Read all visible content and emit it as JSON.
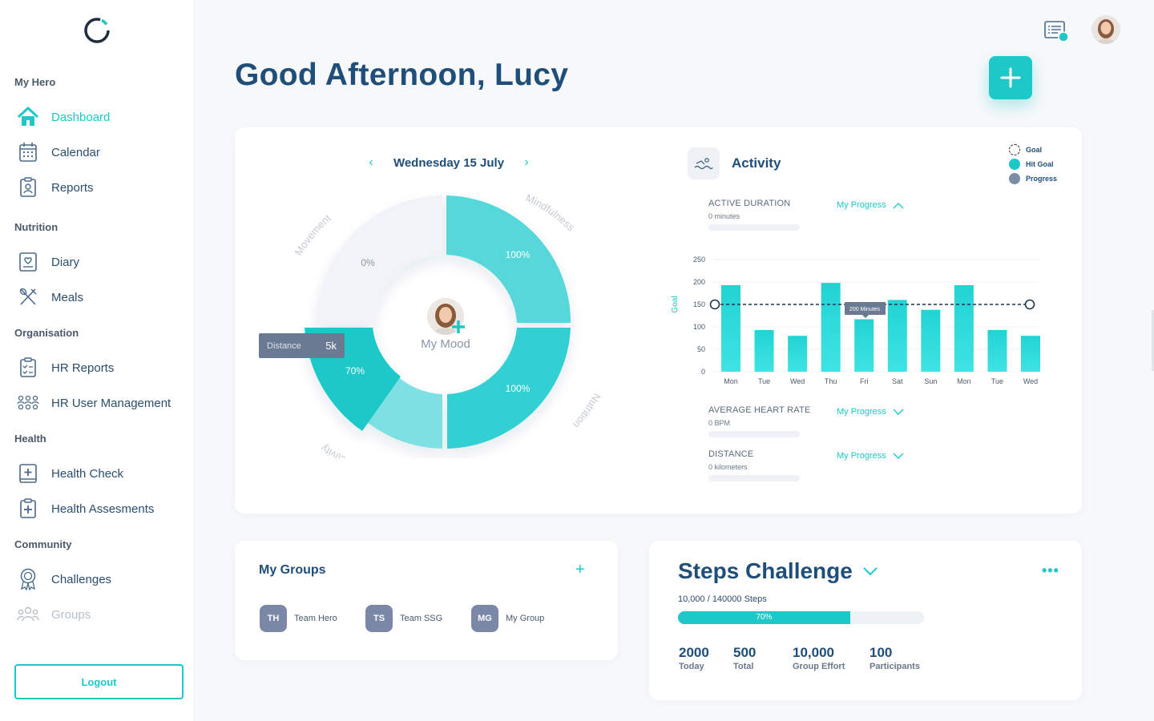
{
  "sidebar": {
    "sections": [
      {
        "title": "My Hero",
        "items": [
          {
            "label": "Dashboard",
            "icon": "home-icon",
            "active": true
          },
          {
            "label": "Calendar",
            "icon": "calendar-icon"
          },
          {
            "label": "Reports",
            "icon": "reports-icon"
          }
        ]
      },
      {
        "title": "Nutrition",
        "items": [
          {
            "label": "Diary",
            "icon": "diary-icon"
          },
          {
            "label": "Meals",
            "icon": "meals-icon"
          }
        ]
      },
      {
        "title": "Organisation",
        "items": [
          {
            "label": "HR Reports",
            "icon": "hr-reports-icon"
          },
          {
            "label": "HR User Management",
            "icon": "users-icon"
          }
        ]
      },
      {
        "title": "Health",
        "items": [
          {
            "label": "Health Check",
            "icon": "health-check-icon"
          },
          {
            "label": "Health Assesments",
            "icon": "health-assessment-icon"
          }
        ]
      },
      {
        "title": "Community",
        "items": [
          {
            "label": "Challenges",
            "icon": "badge-icon"
          },
          {
            "label": "Groups",
            "icon": "groups-icon",
            "muted": true
          }
        ]
      }
    ],
    "logout": "Logout"
  },
  "header": {
    "greeting": "Good Afternoon, Lucy"
  },
  "wheel": {
    "date": "Wednesday 15 July",
    "segments": [
      {
        "name": "Movement",
        "value": "0%"
      },
      {
        "name": "Mindfulness",
        "value": "100%"
      },
      {
        "name": "Nutrition",
        "value": "100%"
      },
      {
        "name": "Activity",
        "value": "70%"
      }
    ],
    "tooltip_label": "Distance",
    "tooltip_value": "5k",
    "mood_label": "My Mood"
  },
  "activity": {
    "title": "Activity",
    "legend": [
      {
        "label": "Goal",
        "color": "#1f2d3d",
        "style": "dashed"
      },
      {
        "label": "Hit Goal",
        "color": "#1ec8c8"
      },
      {
        "label": "Progress",
        "color": "#7b8ea6"
      }
    ],
    "metrics": [
      {
        "title": "ACTIVE DURATION",
        "value": "0 minutes",
        "link": "My Progress"
      },
      {
        "title": "AVERAGE HEART RATE",
        "value": "0 BPM",
        "link": "My Progress"
      },
      {
        "title": "DISTANCE",
        "value": "0 kilometers",
        "link": "My Progress"
      }
    ]
  },
  "chart_data": {
    "type": "bar",
    "categories": [
      "Mon",
      "Tue",
      "Wed",
      "Thu",
      "Fri",
      "Sat",
      "Sun",
      "Mon",
      "Tue",
      "Wed"
    ],
    "values": [
      193,
      93,
      80,
      198,
      117,
      160,
      138,
      193,
      93,
      80
    ],
    "goal": 150,
    "ylim": [
      0,
      250
    ],
    "yticks": [
      0,
      50,
      100,
      150,
      200,
      250
    ],
    "ylabel": "Goal",
    "tooltip": "200 Minutes"
  },
  "groups": {
    "title": "My Groups",
    "add": "+",
    "items": [
      {
        "initials": "TH",
        "name": "Team Hero"
      },
      {
        "initials": "TS",
        "name": "Team SSG"
      },
      {
        "initials": "MG",
        "name": "My Group"
      }
    ]
  },
  "steps": {
    "title": "Steps Challenge",
    "count": "10,000 / 140000 Steps",
    "progress": 70,
    "progress_label": "70%",
    "stats": [
      {
        "value": "2000",
        "label": "Today"
      },
      {
        "value": "500",
        "label": "Total"
      },
      {
        "value": "10,000",
        "label": "Group Effort"
      },
      {
        "value": "100",
        "label": "Participants"
      }
    ]
  }
}
